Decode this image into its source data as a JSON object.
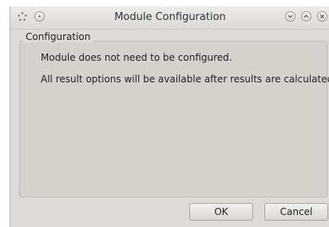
{
  "window": {
    "title": "Module Configuration",
    "buttons": {
      "left": [
        "dots-icon",
        "menu-circle-icon"
      ],
      "right": [
        "minimize-icon",
        "maximize-icon",
        "close-icon"
      ]
    }
  },
  "group": {
    "title": "Configuration",
    "messages": [
      "Module does not need to be configured.",
      "All result options will be available after results are calculated."
    ]
  },
  "footer": {
    "ok_label": "OK",
    "cancel_label": "Cancel"
  },
  "colors": {
    "window_bg": "#dedad7",
    "group_bg": "#d5d1cd",
    "text": "#222222"
  }
}
